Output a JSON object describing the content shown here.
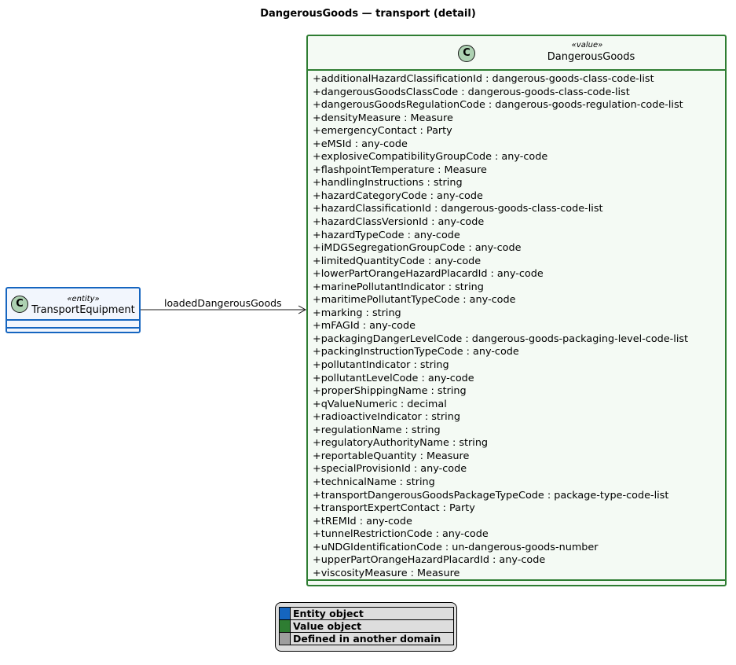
{
  "title": "DangerousGoods — transport (detail)",
  "classes": {
    "transport_equipment": {
      "stereotype": "«entity»",
      "name": "TransportEquipment",
      "icon": "C",
      "color": "#1565C0"
    },
    "dangerous_goods": {
      "stereotype": "«value»",
      "name": "DangerousGoods",
      "icon": "C",
      "color": "#2E7D32",
      "attributes": [
        "+additionalHazardClassificationId : dangerous-goods-class-code-list",
        "+dangerousGoodsClassCode : dangerous-goods-class-code-list",
        "+dangerousGoodsRegulationCode : dangerous-goods-regulation-code-list",
        "+densityMeasure : Measure",
        "+emergencyContact : Party",
        "+eMSId : any-code",
        "+explosiveCompatibilityGroupCode : any-code",
        "+flashpointTemperature : Measure",
        "+handlingInstructions : string",
        "+hazardCategoryCode : any-code",
        "+hazardClassificationId : dangerous-goods-class-code-list",
        "+hazardClassVersionId : any-code",
        "+hazardTypeCode : any-code",
        "+iMDGSegregationGroupCode : any-code",
        "+limitedQuantityCode : any-code",
        "+lowerPartOrangeHazardPlacardId : any-code",
        "+marinePollutantIndicator : string",
        "+maritimePollutantTypeCode : any-code",
        "+marking : string",
        "+mFAGId : any-code",
        "+packagingDangerLevelCode : dangerous-goods-packaging-level-code-list",
        "+packingInstructionTypeCode : any-code",
        "+pollutantIndicator : string",
        "+pollutantLevelCode : any-code",
        "+properShippingName : string",
        "+qValueNumeric : decimal",
        "+radioactiveIndicator : string",
        "+regulationName : string",
        "+regulatoryAuthorityName : string",
        "+reportableQuantity : Measure",
        "+specialProvisionId : any-code",
        "+technicalName : string",
        "+transportDangerousGoodsPackageTypeCode : package-type-code-list",
        "+transportExpertContact : Party",
        "+tREMId : any-code",
        "+tunnelRestrictionCode : any-code",
        "+uNDGIdentificationCode : un-dangerous-goods-number",
        "+upperPartOrangeHazardPlacardId : any-code",
        "+viscosityMeasure : Measure"
      ]
    }
  },
  "association": {
    "label": "loadedDangerousGoods"
  },
  "legend": [
    {
      "label": "Entity object",
      "color": "#1565C0"
    },
    {
      "label": "Value object",
      "color": "#2E7D32"
    },
    {
      "label": "Defined in another domain",
      "color": "#9E9E9E"
    }
  ]
}
